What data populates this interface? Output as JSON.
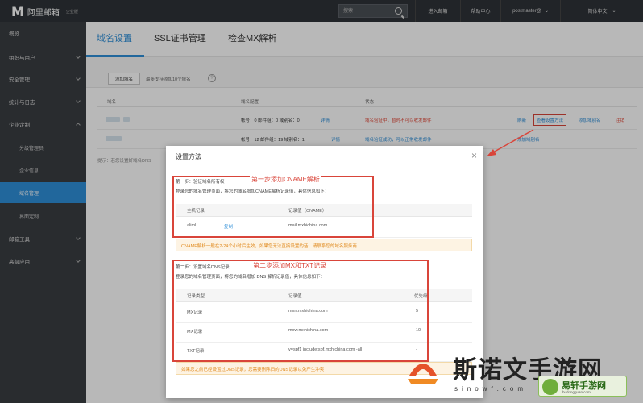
{
  "topbar": {
    "logo_mark": "M",
    "logo_text": "阿里邮箱",
    "logo_sub": "企业版",
    "search_placeholder": "搜索",
    "enter_mail": "进入邮箱",
    "help_center": "帮助中心",
    "user": "postmaster@",
    "language": "简体中文"
  },
  "sidebar": {
    "items": [
      {
        "label": "概览"
      },
      {
        "label": "组织与用户"
      },
      {
        "label": "安全管理"
      },
      {
        "label": "统计与日志"
      },
      {
        "label": "企业定制"
      },
      {
        "label": "分级管理员"
      },
      {
        "label": "企业信息"
      },
      {
        "label": "域名管理"
      },
      {
        "label": "界面定制"
      },
      {
        "label": "邮箱工具"
      },
      {
        "label": "高级应用"
      }
    ]
  },
  "tabs": [
    {
      "label": "域名设置"
    },
    {
      "label": "SSL证书管理"
    },
    {
      "label": "检查MX解析"
    }
  ],
  "toolbar": {
    "add_label": "添加域名",
    "hint": "最多支持添加10个域名",
    "help_glyph": "?"
  },
  "table": {
    "headers": [
      "域名",
      "域名配置",
      "状态"
    ],
    "rows": [
      {
        "config": "帐号：0 邮件组：0 域别名：0",
        "detail": "详情",
        "status": "域名验证中，暂时不可以收发邮件",
        "actions": [
          "刷新",
          "查看设置方法",
          "添加域别名",
          "注销"
        ]
      },
      {
        "config": "帐号：12 邮件组：19 域别名：1",
        "detail": "详情",
        "status": "域名验证成功，可以正常收发邮件",
        "actions": [
          "添加域别名"
        ]
      }
    ],
    "footnote": "提示：若您设置好域名DNS"
  },
  "dialog": {
    "title": "设置方法",
    "close": "×",
    "step1_title": "第一步：验证域名所有权",
    "step1_desc": "登录您的域名管理页面，将您的域名增加CNAME解析记录值，具体信息如下：",
    "step1_headers": [
      "主机记录",
      "记录值（CNAME）"
    ],
    "step1_row": {
      "host": "aliml",
      "copy": "复制",
      "value": "mail.mxhichina.com"
    },
    "step1_notice": "CNAME解析一般在2-24个小时后生效，如果您无法直接设置的话，请联系您的域名服务商",
    "step2_title": "第二步：设置域名DNS记录",
    "step2_desc": "登录您的域名管理页面，将您的域名增加 DNS 解析记录值，具体信息如下：",
    "step2_headers": [
      "记录类型",
      "记录值",
      "优先级"
    ],
    "step2_rows": [
      {
        "type": "MX记录",
        "value": "mxn.mxhichina.com",
        "priority": "5"
      },
      {
        "type": "MX记录",
        "value": "mxw.mxhichina.com",
        "priority": "10"
      },
      {
        "type": "TXT记录",
        "value": "v=spf1 include:spf.mxhichina.com -all",
        "priority": "-"
      }
    ],
    "step2_notice": "如果您之前已经设置过DNS记录，您需要删除旧的DNS记录以免产生冲突"
  },
  "annotations": {
    "step1": "第一步添加CNAME解析",
    "step2": "第二步添加MX和TXT记录",
    "color": "#d9453a"
  },
  "watermark": {
    "title": "斯诺文手游网",
    "url": "sinowf.com",
    "badge_title": "易轩手游网",
    "badge_url": "ibudongguan.com"
  }
}
